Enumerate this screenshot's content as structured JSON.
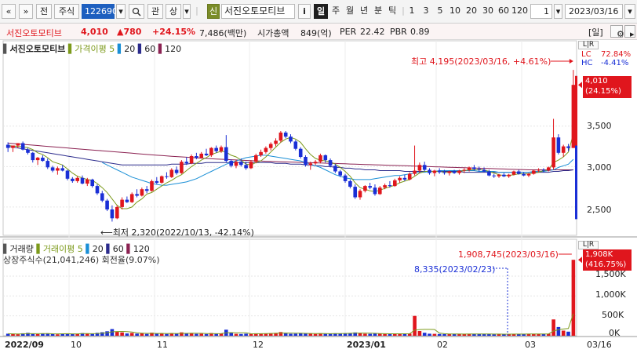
{
  "toolbar": {
    "nav_prev": "«",
    "nav_next": "»",
    "btn_jeon": "전",
    "market_select": "주식",
    "code_input": "122690",
    "search_icon": "search-icon",
    "btn_gwan": "관",
    "btn_sang": "상",
    "btn_sin": "신",
    "stock_name": "서진오토모티브",
    "btn_info": "i",
    "periods": [
      "일",
      "주",
      "월",
      "년",
      "분",
      "틱"
    ],
    "active_period": "일",
    "minutes": [
      "1",
      "3",
      "5",
      "10",
      "20",
      "30",
      "60",
      "120"
    ],
    "count_value": "1",
    "date_value": "2023/03/16"
  },
  "info": {
    "name": "서진오토모티브",
    "price": "4,010",
    "change": "▲780",
    "change_pct": "+24.15%",
    "volume_amount": "7,486(백만)",
    "market_cap_label": "시가총액",
    "market_cap": "849(억)",
    "per_label": "PER",
    "per": "22.42",
    "pbr_label": "PBR",
    "pbr": "0.89",
    "period_btn": "[일]"
  },
  "price_chart": {
    "title": "서진오토모티브",
    "ma_label": "가격이평",
    "ma_periods": [
      "5",
      "20",
      "60",
      "120"
    ],
    "ma_colors": [
      "#7c9a1b",
      "#1a8fd6",
      "#2b2b8c",
      "#8b2252"
    ],
    "lr_label": "L|R",
    "high_note": "최고 4,195(2023/03/16, +4.61%)",
    "low_note": "최저 2,320(2022/10/13, -42.14%)",
    "lc_label": "LC",
    "lc_value": "72.84%",
    "hc_label": "HC",
    "hc_value": "-4.41%",
    "current_price": "4,010",
    "current_pct": "(24.15%)",
    "y_ticks": [
      "3,500",
      "3,000",
      "2,500"
    ],
    "up_color": "#e0161d",
    "down_color": "#1a2fd6"
  },
  "volume_chart": {
    "title": "거래량",
    "ma_label": "거래이평",
    "ma_periods": [
      "5",
      "20",
      "60",
      "120"
    ],
    "shares_label": "상장주식수(21,041,246) 회전율(9.07%)",
    "max_note": "1,908,745(2023/03/16)",
    "prev_note": "8,335(2023/02/23)",
    "current_vol": "1,908K",
    "current_pct": "(416.75%)",
    "y_ticks": [
      "1,500K",
      "1,000K",
      "500K",
      "0K"
    ]
  },
  "x_axis": {
    "labels": [
      "2022/09",
      "10",
      "11",
      "12",
      "2023/01",
      "02",
      "03"
    ],
    "end_label": "03/16"
  },
  "chart_data": {
    "type": "candlestick",
    "y_unit": "KRW",
    "price_range": [
      2150,
      4400
    ],
    "volume_range": [
      0,
      2150000
    ],
    "candles": [
      [
        3270,
        3300,
        3180,
        3230
      ],
      [
        3230,
        3260,
        3180,
        3260
      ],
      [
        3260,
        3290,
        3230,
        3290
      ],
      [
        3290,
        3310,
        3200,
        3210
      ],
      [
        3210,
        3230,
        3150,
        3170
      ],
      [
        3170,
        3180,
        3050,
        3080
      ],
      [
        3080,
        3120,
        3020,
        3110
      ],
      [
        3110,
        3140,
        3060,
        3070
      ],
      [
        3070,
        3100,
        2970,
        2990
      ],
      [
        2990,
        3010,
        2930,
        2950
      ],
      [
        2950,
        3000,
        2900,
        2980
      ],
      [
        2980,
        3020,
        2940,
        2950
      ],
      [
        2950,
        2960,
        2830,
        2850
      ],
      [
        2850,
        2870,
        2800,
        2820
      ],
      [
        2820,
        2880,
        2800,
        2860
      ],
      [
        2860,
        2890,
        2780,
        2790
      ],
      [
        2790,
        2860,
        2760,
        2840
      ],
      [
        2840,
        2850,
        2740,
        2760
      ],
      [
        2760,
        2780,
        2650,
        2670
      ],
      [
        2670,
        2700,
        2560,
        2580
      ],
      [
        2580,
        2600,
        2450,
        2470
      ],
      [
        2470,
        2520,
        2320,
        2360
      ],
      [
        2360,
        2520,
        2350,
        2500
      ],
      [
        2500,
        2620,
        2470,
        2590
      ],
      [
        2590,
        2630,
        2550,
        2560
      ],
      [
        2560,
        2680,
        2550,
        2660
      ],
      [
        2660,
        2720,
        2620,
        2640
      ],
      [
        2640,
        2740,
        2630,
        2720
      ],
      [
        2720,
        2760,
        2670,
        2700
      ],
      [
        2700,
        2840,
        2690,
        2820
      ],
      [
        2820,
        2870,
        2780,
        2800
      ],
      [
        2800,
        2890,
        2790,
        2880
      ],
      [
        2880,
        2930,
        2850,
        2870
      ],
      [
        2870,
        2980,
        2860,
        2960
      ],
      [
        2960,
        3000,
        2900,
        2920
      ],
      [
        2920,
        3080,
        2910,
        3060
      ],
      [
        3060,
        3120,
        3020,
        3040
      ],
      [
        3040,
        3150,
        3030,
        3130
      ],
      [
        3130,
        3170,
        3090,
        3110
      ],
      [
        3110,
        3180,
        3100,
        3160
      ],
      [
        3160,
        3220,
        3130,
        3140
      ],
      [
        3140,
        3240,
        3120,
        3230
      ],
      [
        3230,
        3260,
        3170,
        3190
      ],
      [
        3190,
        3260,
        3170,
        3240
      ],
      [
        3240,
        3390,
        3050,
        3070
      ],
      [
        3070,
        3090,
        2990,
        3010
      ],
      [
        3010,
        3080,
        2980,
        3060
      ],
      [
        3060,
        3100,
        3000,
        3020
      ],
      [
        3020,
        3060,
        2960,
        2980
      ],
      [
        2980,
        3080,
        2970,
        3060
      ],
      [
        3060,
        3160,
        3040,
        3140
      ],
      [
        3140,
        3210,
        3120,
        3180
      ],
      [
        3180,
        3250,
        3160,
        3230
      ],
      [
        3230,
        3300,
        3200,
        3280
      ],
      [
        3280,
        3350,
        3250,
        3320
      ],
      [
        3320,
        3440,
        3300,
        3420
      ],
      [
        3420,
        3440,
        3350,
        3370
      ],
      [
        3370,
        3400,
        3290,
        3310
      ],
      [
        3310,
        3330,
        3200,
        3220
      ],
      [
        3220,
        3240,
        3100,
        3120
      ],
      [
        3120,
        3140,
        3000,
        3020
      ],
      [
        3020,
        3060,
        2960,
        3040
      ],
      [
        3040,
        3080,
        3020,
        3060
      ],
      [
        3060,
        3160,
        3040,
        3140
      ],
      [
        3140,
        3150,
        3050,
        3080
      ],
      [
        3080,
        3100,
        2990,
        3010
      ],
      [
        3010,
        3030,
        2920,
        2940
      ],
      [
        2940,
        2960,
        2870,
        2890
      ],
      [
        2890,
        2910,
        2800,
        2820
      ],
      [
        2820,
        2840,
        2730,
        2750
      ],
      [
        2750,
        2780,
        2600,
        2620
      ],
      [
        2620,
        2720,
        2590,
        2700
      ],
      [
        2700,
        2770,
        2680,
        2760
      ],
      [
        2760,
        2800,
        2720,
        2740
      ],
      [
        2740,
        2780,
        2640,
        2660
      ],
      [
        2660,
        2760,
        2650,
        2740
      ],
      [
        2740,
        2790,
        2720,
        2770
      ],
      [
        2770,
        2820,
        2740,
        2760
      ],
      [
        2760,
        2850,
        2750,
        2830
      ],
      [
        2830,
        2880,
        2800,
        2860
      ],
      [
        2860,
        2900,
        2820,
        2840
      ],
      [
        2840,
        2930,
        2830,
        2910
      ],
      [
        2910,
        3260,
        2890,
        2950
      ],
      [
        2950,
        3050,
        2920,
        3020
      ],
      [
        3020,
        3060,
        2940,
        2960
      ],
      [
        2960,
        2980,
        2900,
        2920
      ],
      [
        2920,
        2960,
        2880,
        2950
      ],
      [
        2950,
        2980,
        2910,
        2930
      ],
      [
        2930,
        2960,
        2900,
        2920
      ],
      [
        2920,
        2950,
        2890,
        2940
      ],
      [
        2940,
        2960,
        2910,
        2920
      ],
      [
        2920,
        2960,
        2900,
        2950
      ],
      [
        2950,
        2980,
        2920,
        2960
      ],
      [
        2960,
        3000,
        2940,
        2990
      ],
      [
        2990,
        3020,
        2950,
        2970
      ],
      [
        2970,
        3000,
        2940,
        2960
      ],
      [
        2960,
        2990,
        2930,
        2940
      ],
      [
        2940,
        2960,
        2880,
        2890
      ],
      [
        2890,
        2910,
        2860,
        2880
      ],
      [
        2880,
        2910,
        2860,
        2900
      ],
      [
        2900,
        2920,
        2870,
        2880
      ],
      [
        2880,
        2910,
        2860,
        2900
      ],
      [
        2900,
        2950,
        2890,
        2940
      ],
      [
        2940,
        2960,
        2900,
        2910
      ],
      [
        2910,
        2930,
        2880,
        2890
      ],
      [
        2890,
        2920,
        2870,
        2910
      ],
      [
        2910,
        2960,
        2900,
        2950
      ],
      [
        2950,
        2980,
        2930,
        2960
      ],
      [
        2960,
        2980,
        2930,
        2950
      ],
      [
        2950,
        3000,
        2940,
        2990
      ],
      [
        2990,
        3590,
        2960,
        3360
      ],
      [
        3360,
        3400,
        3150,
        3170
      ],
      [
        3170,
        3270,
        3120,
        3250
      ],
      [
        3250,
        3280,
        3190,
        3230
      ],
      [
        3230,
        4195,
        3230,
        4010
      ]
    ],
    "volumes": [
      52000,
      41000,
      38000,
      61000,
      72000,
      48000,
      39000,
      55000,
      62000,
      44000,
      36000,
      52000,
      58000,
      47000,
      43000,
      66000,
      51000,
      48000,
      73000,
      88000,
      112000,
      168000,
      96000,
      82000,
      58000,
      71000,
      54000,
      63000,
      45000,
      77000,
      49000,
      58000,
      46000,
      61000,
      52000,
      84000,
      56000,
      63000,
      48000,
      51000,
      44000,
      67000,
      49000,
      58000,
      152000,
      72000,
      48000,
      43000,
      51000,
      46000,
      61000,
      55000,
      58000,
      63000,
      71000,
      92000,
      58000,
      49000,
      54000,
      62000,
      68000,
      51000,
      46000,
      58000,
      47000,
      53000,
      61000,
      57000,
      64000,
      68000,
      82000,
      66000,
      52000,
      48000,
      57000,
      54000,
      46000,
      42000,
      51000,
      58000,
      49000,
      56000,
      500000,
      118000,
      74000,
      52000,
      48000,
      43000,
      41000,
      46000,
      39000,
      44000,
      42000,
      48000,
      43000,
      46000,
      41000,
      39000,
      36000,
      42000,
      38000,
      41000,
      47000,
      43000,
      40000,
      44000,
      48000,
      42000,
      45000,
      49000,
      410000,
      218000,
      128000,
      102000,
      1908745
    ],
    "ma5": [
      3260,
      3255,
      3250,
      3245,
      3235,
      3210,
      3170,
      3150,
      3110,
      3060,
      3040,
      3020,
      2970,
      2920,
      2880,
      2860,
      2840,
      2830,
      2790,
      2740,
      2680,
      2600,
      2520,
      2480,
      2480,
      2500,
      2560,
      2600,
      2660,
      2680,
      2720,
      2760,
      2800,
      2830,
      2870,
      2900,
      2950,
      3000,
      3040,
      3080,
      3110,
      3150,
      3170,
      3190,
      3180,
      3140,
      3120,
      3080,
      3030,
      3020,
      3050,
      3070,
      3120,
      3180,
      3240,
      3300,
      3340,
      3360,
      3340,
      3300,
      3220,
      3150,
      3100,
      3080,
      3070,
      3060,
      3030,
      2990,
      2940,
      2880,
      2800,
      2740,
      2720,
      2700,
      2690,
      2710,
      2730,
      2750,
      2770,
      2800,
      2820,
      2840,
      2880,
      2920,
      2940,
      2940,
      2940,
      2940,
      2930,
      2930,
      2930,
      2940,
      2950,
      2960,
      2960,
      2960,
      2960,
      2940,
      2920,
      2900,
      2890,
      2890,
      2900,
      2910,
      2910,
      2910,
      2920,
      2930,
      2950,
      2960,
      3050,
      3080,
      3120,
      3180,
      3400
    ],
    "ma20_from": 19,
    "ma20": [
      3050,
      3020,
      2990,
      2960,
      2930,
      2900,
      2870,
      2850,
      2830,
      2810,
      2790,
      2780,
      2770,
      2770,
      2780,
      2790,
      2800,
      2810,
      2830,
      2850,
      2880,
      2910,
      2940,
      2970,
      3000,
      3030,
      3050,
      3070,
      3090,
      3110,
      3120,
      3130,
      3140,
      3140,
      3130,
      3120,
      3110,
      3100,
      3090,
      3080,
      3070,
      3050,
      3030,
      3010,
      2990,
      2960,
      2930,
      2900,
      2880,
      2860,
      2850,
      2840,
      2840,
      2840,
      2840,
      2850,
      2860,
      2870,
      2880,
      2890,
      2890,
      2900,
      2910,
      2920,
      2930,
      2930,
      2940,
      2940,
      2950,
      2950,
      2950,
      2950,
      2950,
      2950,
      2950,
      2950,
      2940,
      2940,
      2940,
      2940,
      2930,
      2930,
      2930,
      2930,
      2930,
      2930,
      2930,
      2940,
      2940,
      2940,
      2950,
      2960,
      2990,
      3010,
      3030,
      3090
    ],
    "ma60_from": 0,
    "ma60": [
      3250,
      3240,
      3230,
      3220,
      3210,
      3200,
      3190,
      3180,
      3170,
      3160,
      3150,
      3140,
      3130,
      3120,
      3110,
      3100,
      3090,
      3080,
      3070,
      3060,
      3050,
      3040,
      3030,
      3020,
      3020,
      3020,
      3020,
      3020,
      3020,
      3020,
      3020,
      3020,
      3020,
      3030,
      3030,
      3030,
      3030,
      3040,
      3040,
      3040,
      3050,
      3050,
      3050,
      3050,
      3050,
      3050,
      3050,
      3050,
      3050,
      3050,
      3050,
      3050,
      3050,
      3050,
      3040,
      3040,
      3040,
      3030,
      3030,
      3030,
      3020,
      3020,
      3010,
      3010,
      3000,
      3000,
      2990,
      2990,
      2980,
      2980,
      2970,
      2970,
      2960,
      2960,
      2960,
      2950,
      2950,
      2950,
      2950,
      2950,
      2940,
      2940,
      2940,
      2940,
      2940,
      2940,
      2940,
      2940,
      2940,
      2940,
      2940,
      2940,
      2930,
      2930,
      2930,
      2930,
      2930,
      2930,
      2930,
      2930,
      2930,
      2930,
      2930,
      2930,
      2930,
      2930,
      2930,
      2930,
      2930,
      2930,
      2940,
      2940,
      2950,
      2950,
      2960
    ],
    "ma120_from": 0,
    "ma120": [
      3290,
      3285,
      3280,
      3275,
      3270,
      3265,
      3260,
      3255,
      3250,
      3245,
      3240,
      3235,
      3230,
      3225,
      3220,
      3215,
      3210,
      3205,
      3200,
      3195,
      3190,
      3185,
      3180,
      3175,
      3170,
      3165,
      3160,
      3155,
      3150,
      3145,
      3140,
      3136,
      3132,
      3128,
      3124,
      3120,
      3116,
      3112,
      3108,
      3104,
      3100,
      3097,
      3094,
      3091,
      3088,
      3085,
      3082,
      3079,
      3076,
      3073,
      3070,
      3068,
      3066,
      3064,
      3062,
      3060,
      3058,
      3056,
      3054,
      3052,
      3050,
      3048,
      3046,
      3044,
      3042,
      3040,
      3038,
      3036,
      3034,
      3032,
      3030,
      3028,
      3026,
      3024,
      3022,
      3020,
      3018,
      3016,
      3014,
      3012,
      3010,
      3008,
      3006,
      3004,
      3002,
      3000,
      2998,
      2996,
      2994,
      2992,
      2990,
      2988,
      2986,
      2984,
      2982,
      2980,
      2978,
      2976,
      2974,
      2972,
      2970,
      2968,
      2966,
      2964,
      2962,
      2960,
      2960,
      2960,
      2960,
      2960,
      2960,
      2960,
      2960,
      2960,
      2960
    ]
  }
}
